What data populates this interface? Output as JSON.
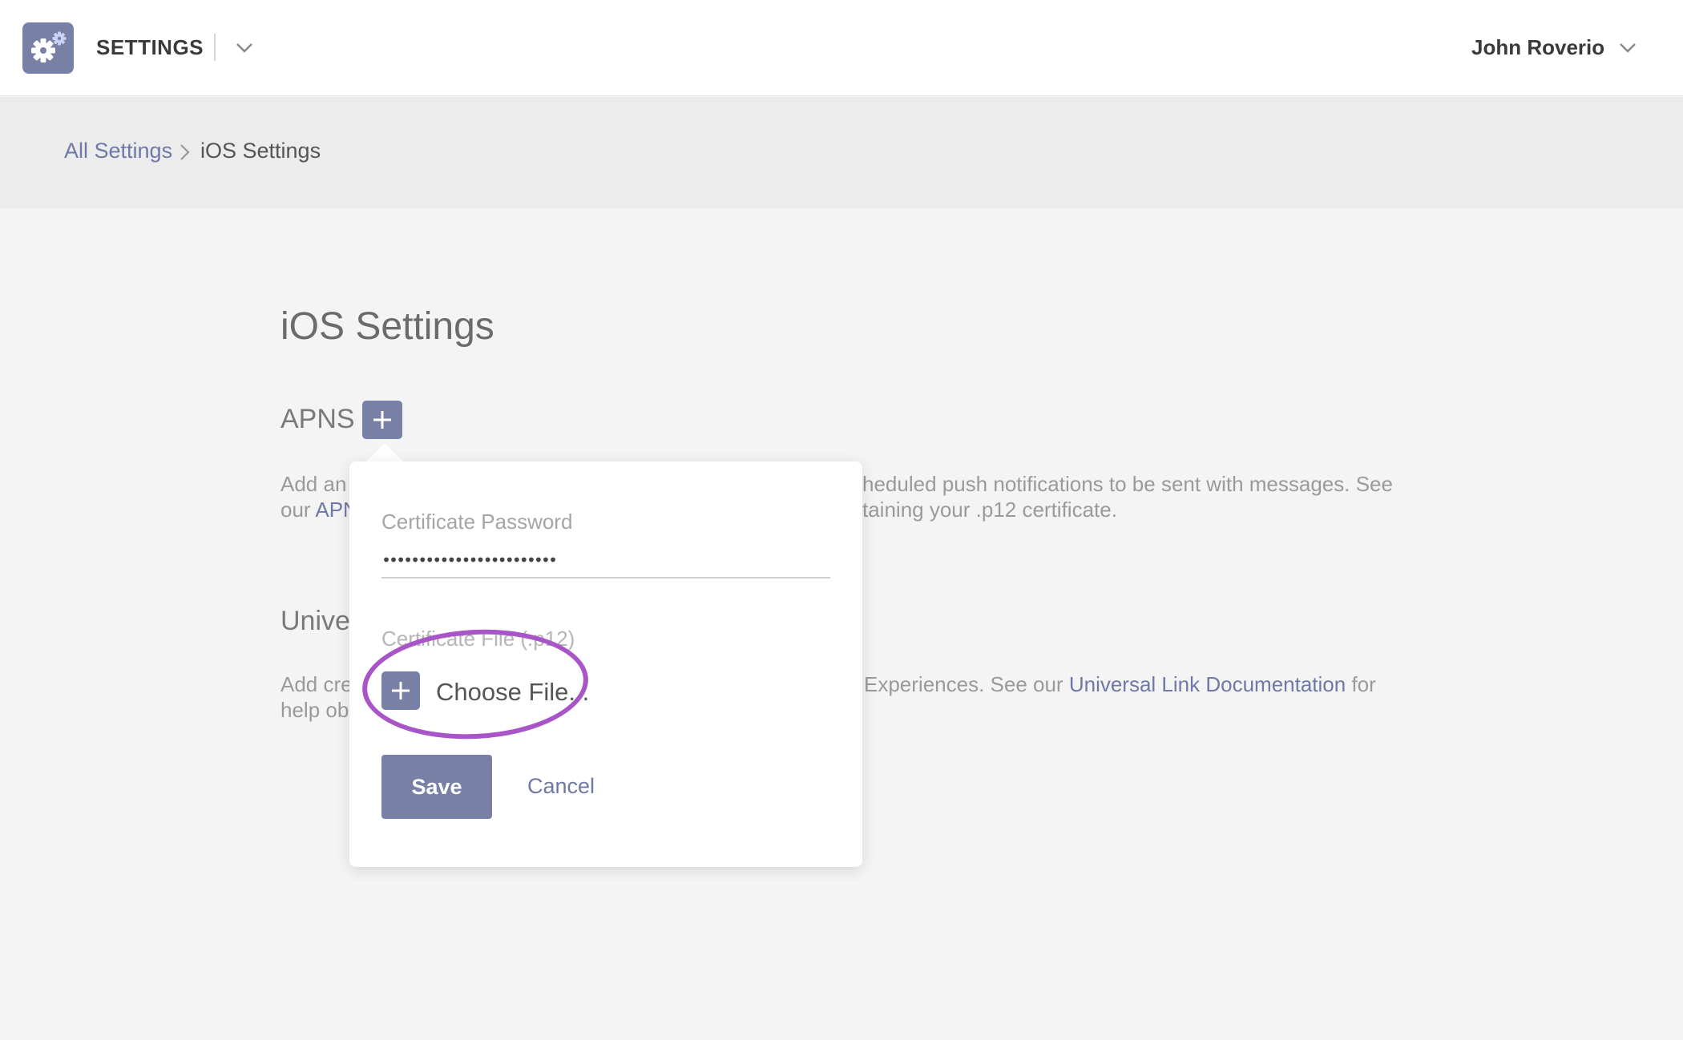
{
  "header": {
    "app_name": "SETTINGS",
    "user_name": "John Roverio"
  },
  "breadcrumb": {
    "root": "All Settings",
    "current": "iOS Settings"
  },
  "page": {
    "title": "iOS Settings"
  },
  "apns": {
    "heading": "APNS",
    "desc_line1_left": "Add an",
    "desc_line1_right": "heduled push notifications to be sent with messages. See",
    "desc_line2_left": "our",
    "desc_line2_link": "APN",
    "desc_line2_right": "taining your .p12 certificate."
  },
  "universal": {
    "heading": "Unive",
    "desc_line1_left": "Add cre",
    "desc_line1_right": "Experiences. See our",
    "desc_line1_link": "Universal Link Documentation",
    "desc_line1_tail": "for",
    "desc_line2_left": "help ob"
  },
  "popover": {
    "password_label": "Certificate Password",
    "password_value": "••••••••••••••••••••••••",
    "file_label": "Certificate File (.p12)",
    "choose_file": "Choose File...",
    "save": "Save",
    "cancel": "Cancel"
  },
  "colors": {
    "accent": "#7880a6",
    "highlight": "#a855c8",
    "background": "#f4f4f4"
  },
  "icons": {
    "logo": "gear-icon",
    "app_switch": "chevron-down-icon",
    "user_menu": "chevron-down-icon",
    "breadcrumb_sep": "chevron-right-icon",
    "add": "plus-icon"
  }
}
